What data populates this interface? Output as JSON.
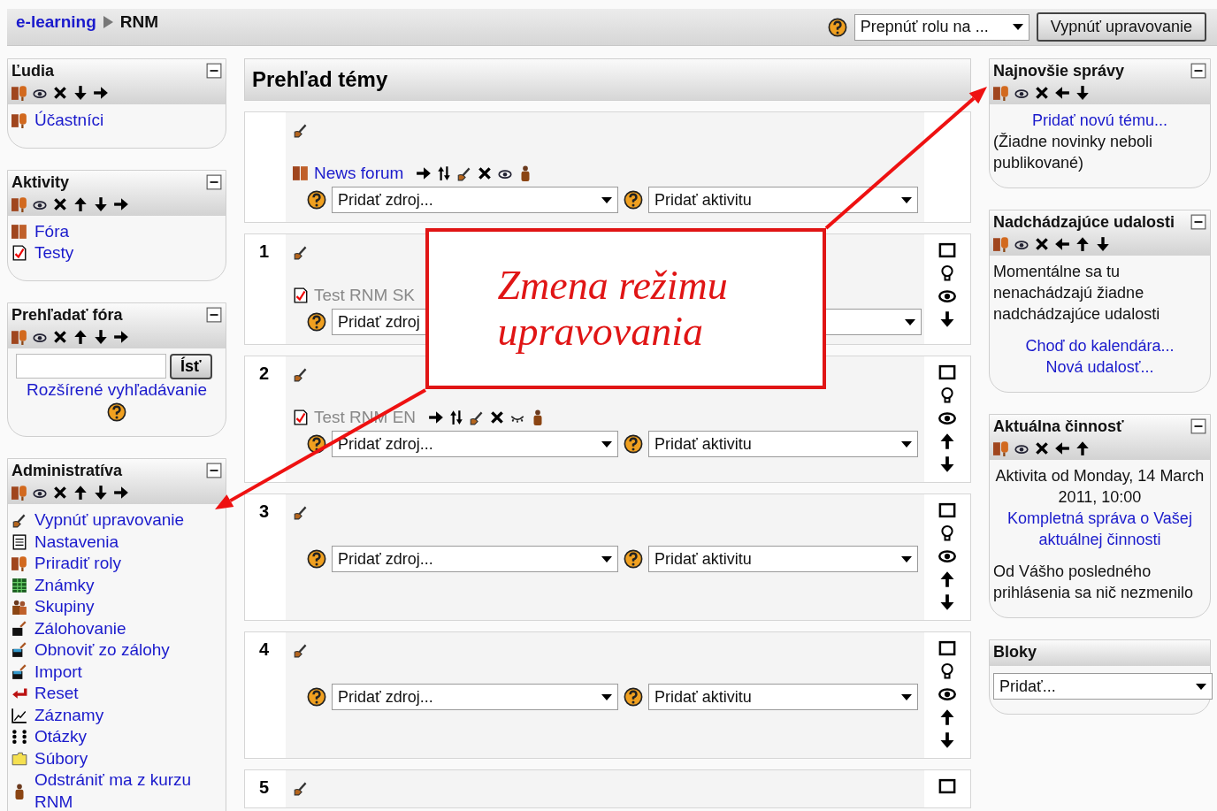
{
  "breadcrumb": [
    {
      "text": "e-learning",
      "link": true
    },
    {
      "text": "RNM",
      "link": false
    }
  ],
  "header": {
    "role_select": "Prepnúť rolu na ...",
    "edit_button": "Vypnúť upravovanie"
  },
  "left_blocks": [
    {
      "title": "Ľudia",
      "collapse_icon": true,
      "controls": [
        {
          "kind": "roles"
        },
        {
          "kind": "hide"
        },
        {
          "kind": "delete"
        },
        {
          "kind": "down"
        },
        {
          "kind": "right"
        }
      ],
      "kind": "links",
      "items": [
        {
          "label": "Účastníci",
          "kind": "roles"
        }
      ]
    },
    {
      "title": "Aktivity",
      "collapse_icon": true,
      "controls": [
        {
          "kind": "roles"
        },
        {
          "kind": "hide"
        },
        {
          "kind": "delete"
        },
        {
          "kind": "up"
        },
        {
          "kind": "down"
        },
        {
          "kind": "right"
        }
      ],
      "kind": "links",
      "items": [
        {
          "label": "Fóra",
          "kind": "forum"
        },
        {
          "label": "Testy",
          "kind": "quiz"
        }
      ]
    },
    {
      "title": "Prehľadať fóra",
      "collapse_icon": true,
      "controls": [
        {
          "kind": "roles"
        },
        {
          "kind": "hide"
        },
        {
          "kind": "delete"
        },
        {
          "kind": "up"
        },
        {
          "kind": "down"
        },
        {
          "kind": "right"
        }
      ],
      "kind": "search",
      "button": "Ísť",
      "link": "Rozšírené vyhľadávanie"
    },
    {
      "title": "Administratíva",
      "collapse_icon": true,
      "controls": [
        {
          "kind": "roles"
        },
        {
          "kind": "hide"
        },
        {
          "kind": "delete"
        },
        {
          "kind": "up"
        },
        {
          "kind": "down"
        },
        {
          "kind": "right"
        }
      ],
      "kind": "links",
      "items": [
        {
          "label": "Vypnúť upravovanie",
          "kind": "edit"
        },
        {
          "label": "Nastavenia",
          "kind": "doc"
        },
        {
          "label": "Priradiť roly",
          "kind": "roles"
        },
        {
          "label": "Známky",
          "kind": "grades"
        },
        {
          "label": "Skupiny",
          "kind": "groups"
        },
        {
          "label": "Zálohovanie",
          "kind": "backup"
        },
        {
          "label": "Obnoviť zo zálohy",
          "kind": "restore"
        },
        {
          "label": "Import",
          "kind": "restore"
        },
        {
          "label": "Reset",
          "kind": "reset"
        },
        {
          "label": "Záznamy",
          "kind": "logs"
        },
        {
          "label": "Otázky",
          "kind": "questions"
        },
        {
          "label": "Súbory",
          "kind": "folder"
        },
        {
          "label": "Odstrániť ma z kurzu RNM",
          "kind": "person"
        }
      ]
    }
  ],
  "course": {
    "title": "Prehľad témy",
    "sections": [
      {
        "activities": [
          {
            "name": "News forum",
            "kind": "forum",
            "dimmed": false,
            "controls": [
              {
                "kind": "right"
              },
              {
                "kind": "updown"
              },
              {
                "kind": "edit"
              },
              {
                "kind": "delete"
              },
              {
                "kind": "hide"
              },
              {
                "kind": "person"
              }
            ]
          }
        ],
        "resource_select": "Pridať zdroj...",
        "activity_select": "Pridať aktivitu",
        "partly_covered": false
      },
      {
        "number": "1",
        "activities": [
          {
            "name": "Test RNM SK",
            "kind": "quiz",
            "dimmed": true
          }
        ],
        "resource_select": "Pridať zdroj",
        "partly_covered": true,
        "side_controls": [
          {
            "kind": "square"
          },
          {
            "kind": "bulb"
          },
          {
            "kind": "eye"
          },
          {
            "kind": "down"
          }
        ]
      },
      {
        "number": "2",
        "activities": [
          {
            "name": "Test RNM EN",
            "kind": "quiz",
            "dimmed": true,
            "controls": [
              {
                "kind": "right"
              },
              {
                "kind": "updown"
              },
              {
                "kind": "edit"
              },
              {
                "kind": "delete"
              },
              {
                "kind": "closed"
              },
              {
                "kind": "person"
              }
            ]
          }
        ],
        "resource_select": "Pridať zdroj...",
        "activity_select": "Pridať aktivitu",
        "partly_covered": false,
        "side_controls": [
          {
            "kind": "square"
          },
          {
            "kind": "bulb"
          },
          {
            "kind": "eye"
          },
          {
            "kind": "up"
          },
          {
            "kind": "down"
          }
        ]
      },
      {
        "number": "3",
        "resource_select": "Pridať zdroj...",
        "activity_select": "Pridať aktivitu",
        "partly_covered": false,
        "side_controls": [
          {
            "kind": "square"
          },
          {
            "kind": "bulb"
          },
          {
            "kind": "eye"
          },
          {
            "kind": "up"
          },
          {
            "kind": "down"
          }
        ]
      },
      {
        "number": "4",
        "resource_select": "Pridať zdroj...",
        "activity_select": "Pridať aktivitu",
        "partly_covered": false,
        "side_controls": [
          {
            "kind": "square"
          },
          {
            "kind": "bulb"
          },
          {
            "kind": "eye"
          },
          {
            "kind": "up"
          },
          {
            "kind": "down"
          }
        ]
      },
      {
        "number": "5",
        "side_controls": [
          {
            "kind": "square"
          }
        ]
      }
    ]
  },
  "right_blocks": [
    {
      "title": "Najnovšie správy",
      "collapse_icon": true,
      "controls": [
        {
          "kind": "roles"
        },
        {
          "kind": "hide"
        },
        {
          "kind": "delete"
        },
        {
          "kind": "left"
        },
        {
          "kind": "down"
        }
      ],
      "kind": "text",
      "groups": [
        {
          "paragraphs": [
            {
              "text": "Pridať novú tému...",
              "link": true,
              "centered": true
            },
            {
              "text": "(Žiadne novinky neboli publikované)",
              "link": false,
              "centered": false
            }
          ]
        }
      ]
    },
    {
      "title": "Nadchádzajúce udalosti",
      "collapse_icon": true,
      "controls": [
        {
          "kind": "roles"
        },
        {
          "kind": "hide"
        },
        {
          "kind": "delete"
        },
        {
          "kind": "left"
        },
        {
          "kind": "up"
        },
        {
          "kind": "down"
        }
      ],
      "kind": "text",
      "groups": [
        {
          "paragraphs": [
            {
              "text": "Momentálne sa tu nenachádzajú žiadne nadchádzajúce udalosti",
              "link": false,
              "centered": false
            }
          ]
        },
        {
          "paragraphs": [
            {
              "text": "Choď do kalendára...",
              "link": true,
              "centered": true
            },
            {
              "text": "Nová udalosť...",
              "link": true,
              "centered": true
            }
          ]
        }
      ]
    },
    {
      "title": "Aktuálna činnosť",
      "collapse_icon": true,
      "controls": [
        {
          "kind": "roles"
        },
        {
          "kind": "hide"
        },
        {
          "kind": "delete"
        },
        {
          "kind": "left"
        },
        {
          "kind": "up"
        }
      ],
      "kind": "text",
      "groups": [
        {
          "paragraphs": [
            {
              "text": "Aktivita od Monday, 14 March 2011, 10:00",
              "link": false,
              "centered": true
            },
            {
              "text": "Kompletná správa o Vašej aktuálnej činnosti",
              "link": true,
              "centered": true
            }
          ]
        },
        {
          "paragraphs": [
            {
              "text": "Od Vášho posledného prihlásenia sa nič nezmenilo",
              "link": false,
              "centered": false
            }
          ]
        }
      ]
    },
    {
      "title": "Bloky",
      "collapse_icon": false,
      "kind": "select",
      "value": "Pridať..."
    }
  ],
  "callout": {
    "text": "Zmena režimu upravovania"
  }
}
